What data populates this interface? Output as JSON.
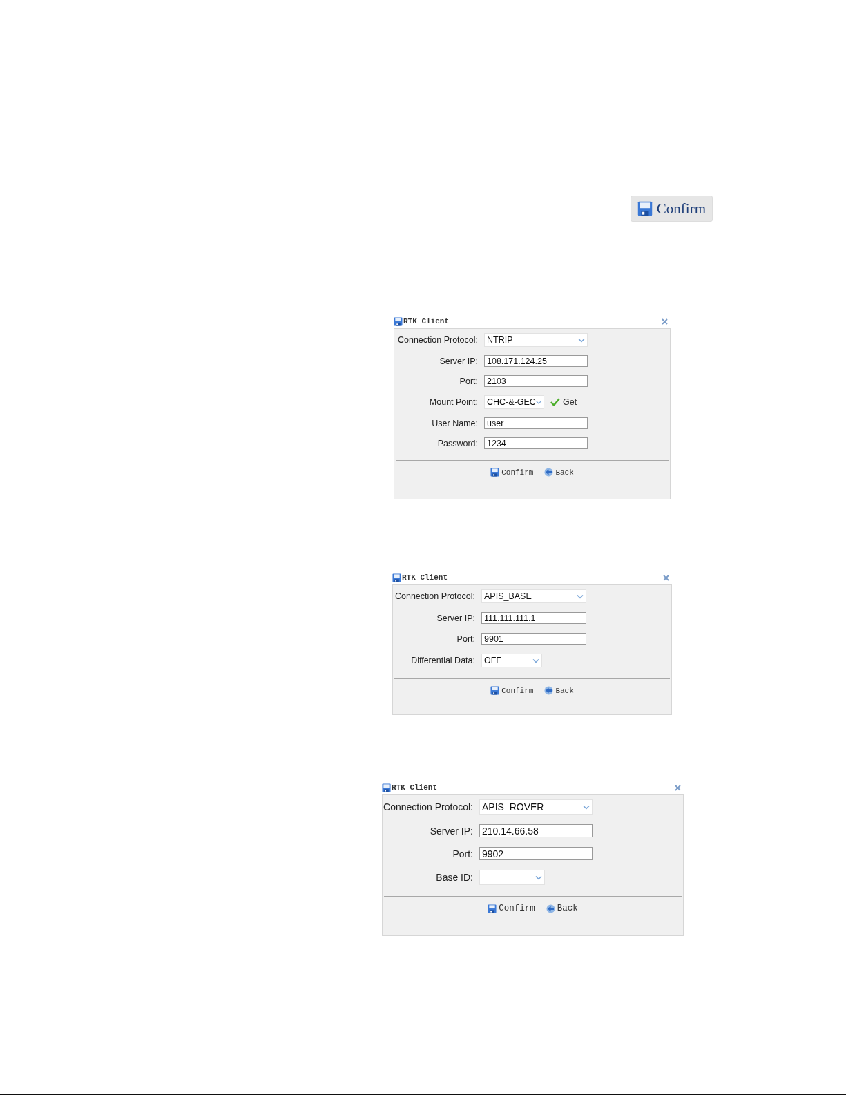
{
  "confirm_button": {
    "label": "Confirm"
  },
  "dialogs": [
    {
      "title": "RTK Client",
      "fields": [
        {
          "label": "Connection Protocol:",
          "kind": "select",
          "value": "NTRIP"
        },
        {
          "label": "Server IP:",
          "kind": "text",
          "value": "108.171.124.25"
        },
        {
          "label": "Port:",
          "kind": "text",
          "value": "2103"
        },
        {
          "label": "Mount Point:",
          "kind": "short_select",
          "value": "CHC-&-GEC",
          "action": "Get"
        },
        {
          "label": "User Name:",
          "kind": "text",
          "value": "user"
        },
        {
          "label": "Password:",
          "kind": "text",
          "value": "1234"
        }
      ],
      "buttons": [
        {
          "label": "Confirm",
          "kind": "confirm"
        },
        {
          "label": "Back",
          "kind": "back"
        }
      ]
    },
    {
      "title": "RTK Client",
      "fields": [
        {
          "label": "Connection Protocol:",
          "kind": "select",
          "value": "APIS_BASE"
        },
        {
          "label": "Server IP:",
          "kind": "text",
          "value": "111.111.111.1"
        },
        {
          "label": "Port:",
          "kind": "text",
          "value": "9901"
        },
        {
          "label": "Differential Data:",
          "kind": "short_select",
          "value": "OFF"
        }
      ],
      "buttons": [
        {
          "label": "Confirm",
          "kind": "confirm"
        },
        {
          "label": "Back",
          "kind": "back"
        }
      ]
    },
    {
      "title": "RTK Client",
      "fields": [
        {
          "label": "Connection Protocol:",
          "kind": "select",
          "value": "APIS_ROVER"
        },
        {
          "label": "Server IP:",
          "kind": "text",
          "value": "210.14.66.58"
        },
        {
          "label": "Port:",
          "kind": "text",
          "value": "9902"
        },
        {
          "label": "Base ID:",
          "kind": "short_select"
        }
      ],
      "buttons": [
        {
          "label": "Confirm",
          "kind": "confirm"
        },
        {
          "label": "Back",
          "kind": "back"
        }
      ]
    }
  ]
}
